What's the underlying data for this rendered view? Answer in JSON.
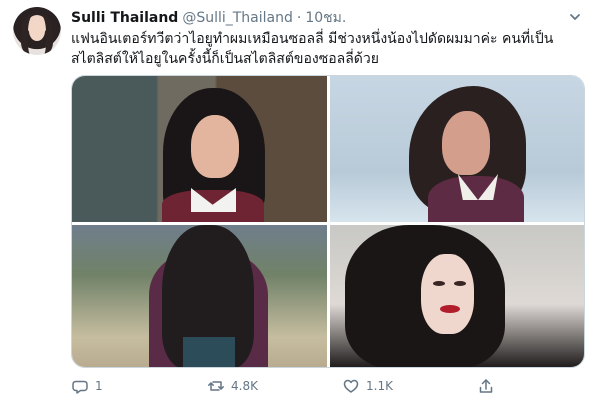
{
  "tweet": {
    "author_name": "Sulli Thailand",
    "handle": "@Sulli_Thailand",
    "separator": "·",
    "timestamp": "10ชม.",
    "text": "แฟนอินเตอร์ทวีตว่าไอยูทำผมเหมือนซอลลี่ มีช่วงหนึ่งน้องไปดัดผมมาค่ะ คนที่เป็น\nสไตลิสต์ให้ไอยูในครั้งนี้ก็เป็นสไตลิสต์ของซอลลี่ด้วย",
    "images": [
      "photo-top-left",
      "photo-top-right",
      "photo-bottom-left",
      "photo-bottom-right"
    ],
    "actions": {
      "replies": "1",
      "retweets": "4.8K",
      "likes": "1.1K"
    }
  },
  "icons": {
    "more": "chevron-down-icon",
    "reply": "reply-icon",
    "retweet": "retweet-icon",
    "like": "heart-icon",
    "share": "share-icon"
  },
  "colors": {
    "text_primary": "#14171a",
    "text_secondary": "#657786",
    "border": "#ccd6dd",
    "background": "#ffffff"
  }
}
